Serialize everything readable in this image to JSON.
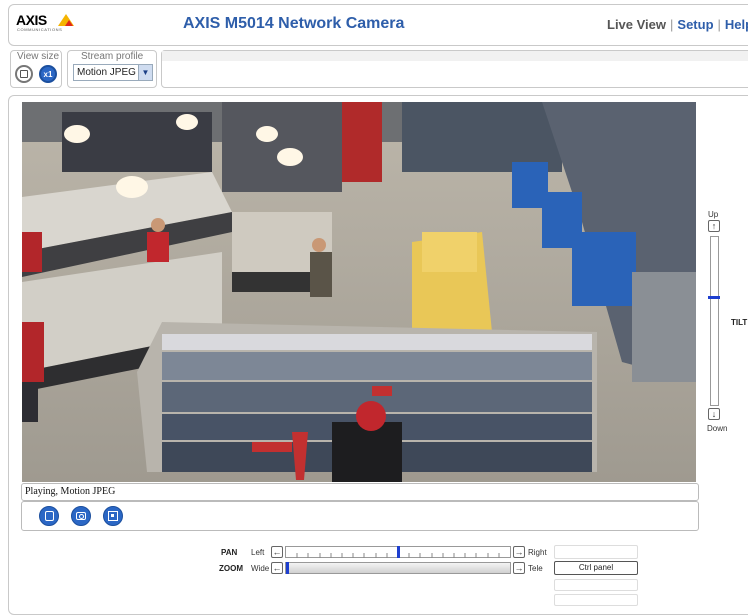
{
  "header": {
    "logo_text": "AXIS",
    "logo_sub": "COMMUNICATIONS",
    "title": "AXIS M5014 Network Camera",
    "nav": {
      "live_view": "Live View",
      "sep": "|",
      "setup": "Setup",
      "help": "Help"
    }
  },
  "controls": {
    "view_size_label": "View size",
    "view_size_x1": "x1",
    "stream_profile_label": "Stream profile",
    "stream_profile_value": "Motion JPEG"
  },
  "status": {
    "text": "Playing, Motion JPEG"
  },
  "ptz": {
    "tilt_up": "Up",
    "tilt_down": "Down",
    "tilt_label": "TILT",
    "tilt_position": 0.36,
    "pan_label": "PAN",
    "pan_left": "Left",
    "pan_right": "Right",
    "pan_position": 0.5,
    "zoom_label": "ZOOM",
    "zoom_wide": "Wide",
    "zoom_tele": "Tele",
    "zoom_position": 0.0,
    "ctrl_panel_label": "Ctrl panel"
  },
  "colors": {
    "accent": "#2e5eaa",
    "slider_thumb": "#1e3fd0",
    "button_blue": "#2b67c5"
  }
}
